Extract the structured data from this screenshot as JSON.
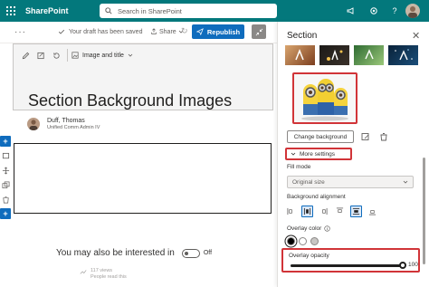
{
  "suite_bar": {
    "app_name": "SharePoint",
    "search_placeholder": "Search in SharePoint",
    "help_label": "?"
  },
  "command_bar": {
    "draft_status": "Your draft has been saved",
    "share_label": "Share",
    "republish_label": "Republish"
  },
  "section_toolbar": {
    "layout_label": "Image and title"
  },
  "page": {
    "title": "Section Background Images",
    "author_name": "Duff, Thomas",
    "author_title": "Unified Comm Admin IV",
    "interested_label": "You may also be interested in",
    "interested_state": "Off",
    "news_views": "117 views",
    "news_subtitle": "People read this"
  },
  "panel": {
    "title": "Section",
    "change_background_label": "Change background",
    "more_settings_label": "More settings",
    "fill_mode_label": "Fill mode",
    "fill_mode_value": "Original size",
    "background_alignment_label": "Background alignment",
    "overlay_color_label": "Overlay color",
    "overlay_opacity_label": "Overlay opacity",
    "overlay_opacity_value": "100",
    "overlay_opacity_fraction": 1.0,
    "overlay_swatches": [
      "#000000",
      "#ffffff",
      "#c8c6c4"
    ],
    "alignment_selected_index": 1
  },
  "colors": {
    "suite_bar": "#03787c",
    "accent": "#0f6cbd",
    "highlight": "#d13438"
  }
}
